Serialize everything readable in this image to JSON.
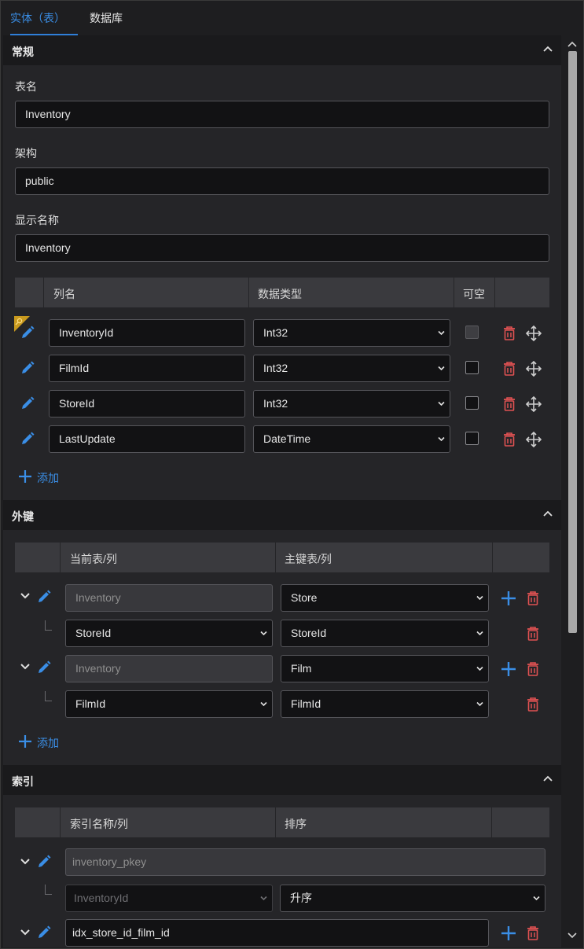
{
  "tabs": [
    {
      "label": "实体（表）",
      "active": true
    },
    {
      "label": "数据库",
      "active": false
    }
  ],
  "general": {
    "title": "常规",
    "table_name_label": "表名",
    "table_name_value": "Inventory",
    "schema_label": "架构",
    "schema_value": "public",
    "display_name_label": "显示名称",
    "display_name_value": "Inventory",
    "columns_headers": {
      "name": "列名",
      "type": "数据类型",
      "nullable": "可空"
    },
    "columns": [
      {
        "name": "InventoryId",
        "type": "Int32",
        "nullable": false,
        "primary_key": true
      },
      {
        "name": "FilmId",
        "type": "Int32",
        "nullable": false,
        "primary_key": false
      },
      {
        "name": "StoreId",
        "type": "Int32",
        "nullable": false,
        "primary_key": false
      },
      {
        "name": "LastUpdate",
        "type": "DateTime",
        "nullable": false,
        "primary_key": false
      }
    ],
    "add_label": "添加"
  },
  "foreign_keys": {
    "title": "外键",
    "headers": {
      "current": "当前表/列",
      "primary": "主键表/列"
    },
    "items": [
      {
        "current_table": "Inventory",
        "primary_table": "Store",
        "current_column": "StoreId",
        "primary_column": "StoreId"
      },
      {
        "current_table": "Inventory",
        "primary_table": "Film",
        "current_column": "FilmId",
        "primary_column": "FilmId"
      }
    ],
    "add_label": "添加"
  },
  "indexes": {
    "title": "索引",
    "headers": {
      "name": "索引名称/列",
      "order": "排序"
    },
    "items": [
      {
        "name": "inventory_pkey",
        "column": "InventoryId",
        "order": "升序",
        "disabled": true
      },
      {
        "name": "idx_store_id_film_id",
        "disabled": false
      }
    ]
  },
  "colors": {
    "accent": "#3a8ee6",
    "delete": "#e05252",
    "background": "#252528",
    "header": "#1a1a1c"
  }
}
